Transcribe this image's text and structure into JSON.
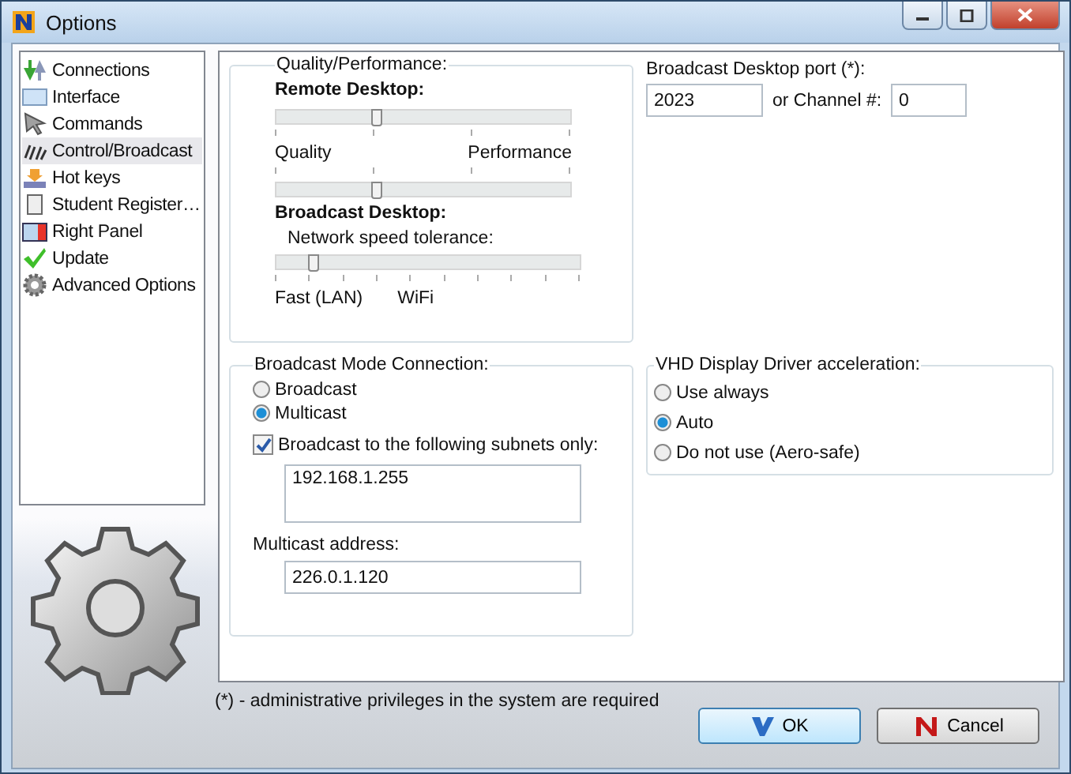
{
  "window": {
    "title": "Options"
  },
  "sidebar": {
    "items": [
      {
        "label": "Connections",
        "selected": false
      },
      {
        "label": "Interface",
        "selected": false
      },
      {
        "label": "Commands",
        "selected": false
      },
      {
        "label": "Control/Broadcast",
        "selected": true
      },
      {
        "label": "Hot keys",
        "selected": false
      },
      {
        "label": "Student Register…",
        "selected": false
      },
      {
        "label": "Right Panel",
        "selected": false
      },
      {
        "label": "Update",
        "selected": false
      },
      {
        "label": "Advanced Options",
        "selected": false
      }
    ]
  },
  "quality": {
    "title": "Quality/Performance:",
    "remote_heading": "Remote Desktop:",
    "remote_slider": {
      "level": 0.34
    },
    "left_label": "Quality",
    "right_label": "Performance",
    "second_slider": {
      "level": 0.34
    },
    "broadcast_heading": "Broadcast Desktop:",
    "tolerance_label": "Network speed tolerance:",
    "tolerance_slider": {
      "level": 0.12
    },
    "fast_label": "Fast (LAN)",
    "wifi_label": "WiFi"
  },
  "port": {
    "label": "Broadcast Desktop port (*):",
    "value": "2023",
    "channel_label": "or Channel #:",
    "channel_value": "0"
  },
  "mode": {
    "title": "Broadcast Mode Connection:",
    "options": [
      {
        "label": "Broadcast",
        "selected": false
      },
      {
        "label": "Multicast",
        "selected": true
      }
    ],
    "subnets_checkbox": {
      "label": "Broadcast to the following subnets only:",
      "checked": true
    },
    "subnets_value": "192.168.1.255",
    "multicast_label": "Multicast address:",
    "multicast_value": "226.0.1.120"
  },
  "vhd": {
    "title": "VHD Display Driver acceleration:",
    "options": [
      {
        "label": "Use always",
        "selected": false
      },
      {
        "label": "Auto",
        "selected": true
      },
      {
        "label": "Do not use (Aero-safe)",
        "selected": false
      }
    ]
  },
  "footnote": "(*) - administrative privileges in the system are required",
  "buttons": [
    {
      "label": "OK",
      "kind": "ok"
    },
    {
      "label": "Cancel",
      "kind": "cancel"
    }
  ]
}
